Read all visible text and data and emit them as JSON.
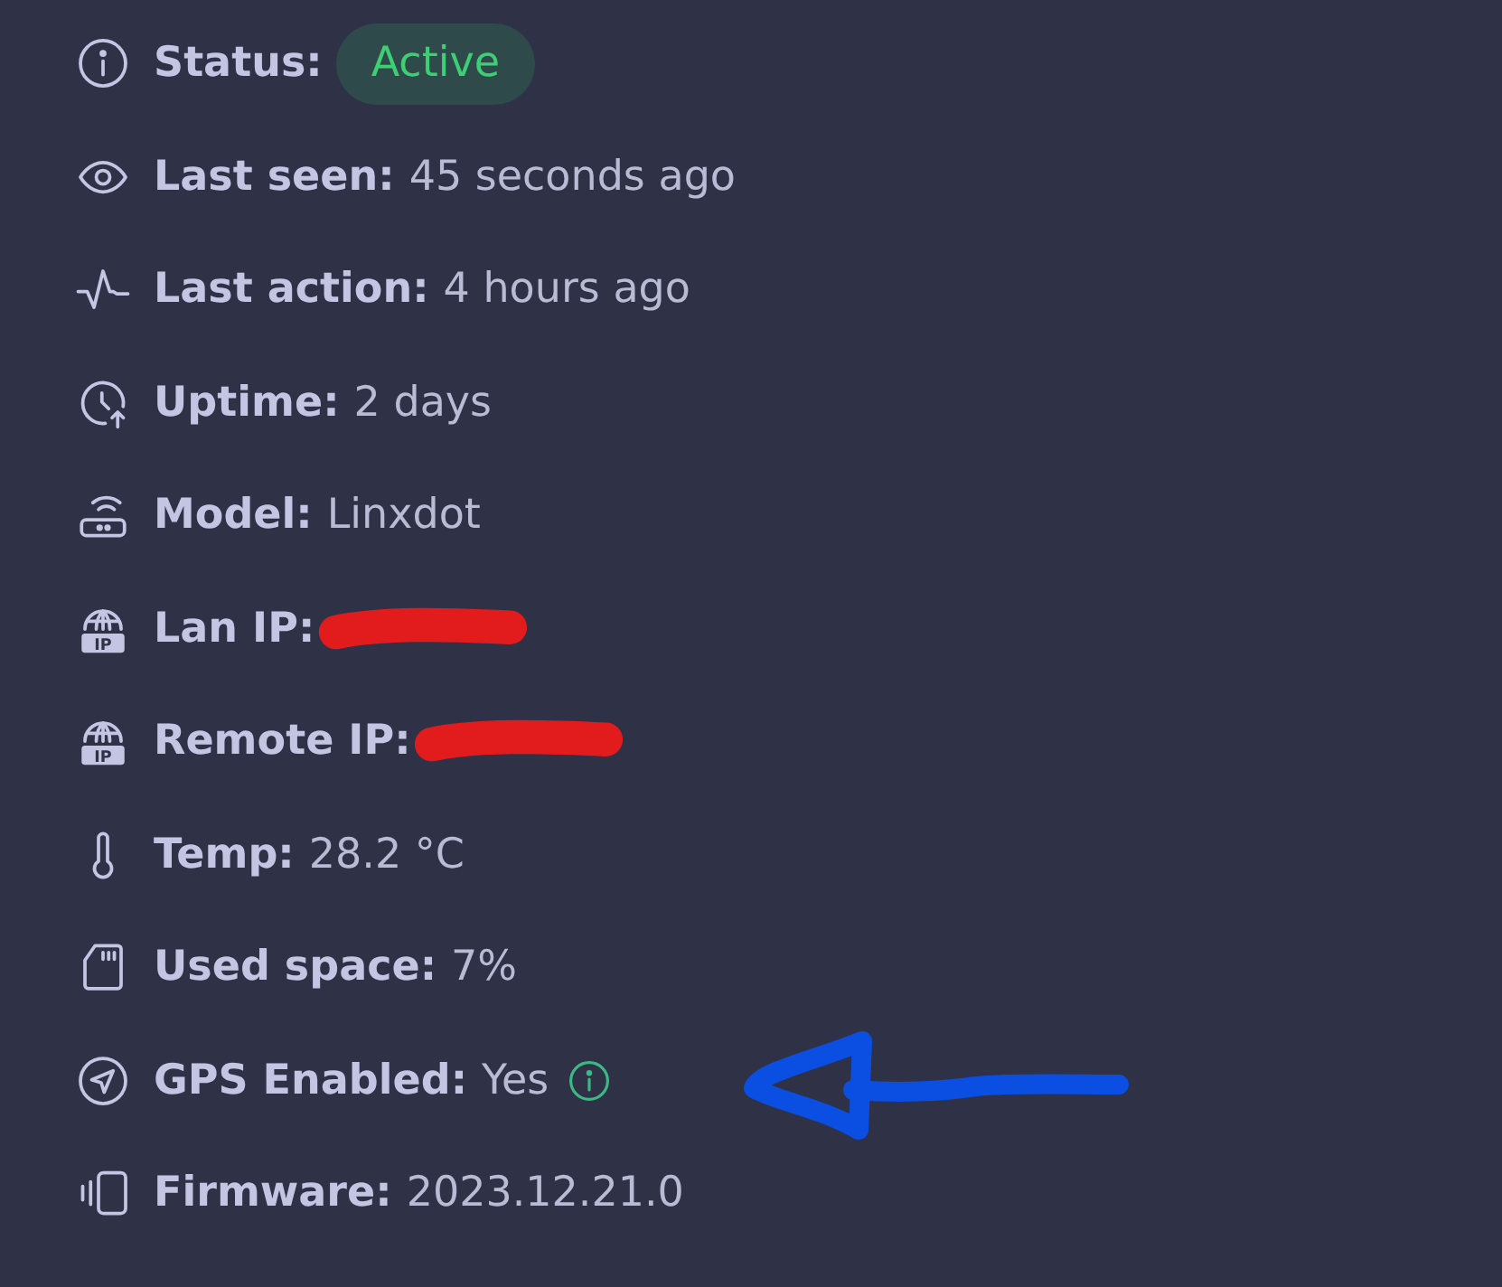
{
  "details": [
    {
      "label": "Status:",
      "kind": "badge",
      "value": "Active",
      "arrow_annotation": false
    },
    {
      "label": "Last seen:",
      "kind": "text",
      "value": "45 seconds ago",
      "arrow_annotation": false
    },
    {
      "label": "Last action:",
      "kind": "text",
      "value": "4 hours ago",
      "arrow_annotation": false
    },
    {
      "label": "Uptime:",
      "kind": "text",
      "value": "2 days",
      "arrow_annotation": false
    },
    {
      "label": "Model:",
      "kind": "text",
      "value": "Linxdot",
      "arrow_annotation": false
    },
    {
      "label": "Lan IP:",
      "kind": "redacted",
      "icon_label": "IP",
      "arrow_annotation": false
    },
    {
      "label": "Remote IP:",
      "kind": "redacted",
      "icon_label": "IP",
      "arrow_annotation": false
    },
    {
      "label": "Temp:",
      "kind": "text",
      "value": "28.2 °C",
      "arrow_annotation": false
    },
    {
      "label": "Used space:",
      "kind": "text",
      "value": "7%",
      "arrow_annotation": false
    },
    {
      "label": "GPS Enabled:",
      "kind": "text_info",
      "value": "Yes",
      "arrow_annotation": true
    },
    {
      "label": "Firmware:",
      "kind": "text",
      "value": "2023.12.21.0",
      "arrow_annotation": false
    }
  ]
}
